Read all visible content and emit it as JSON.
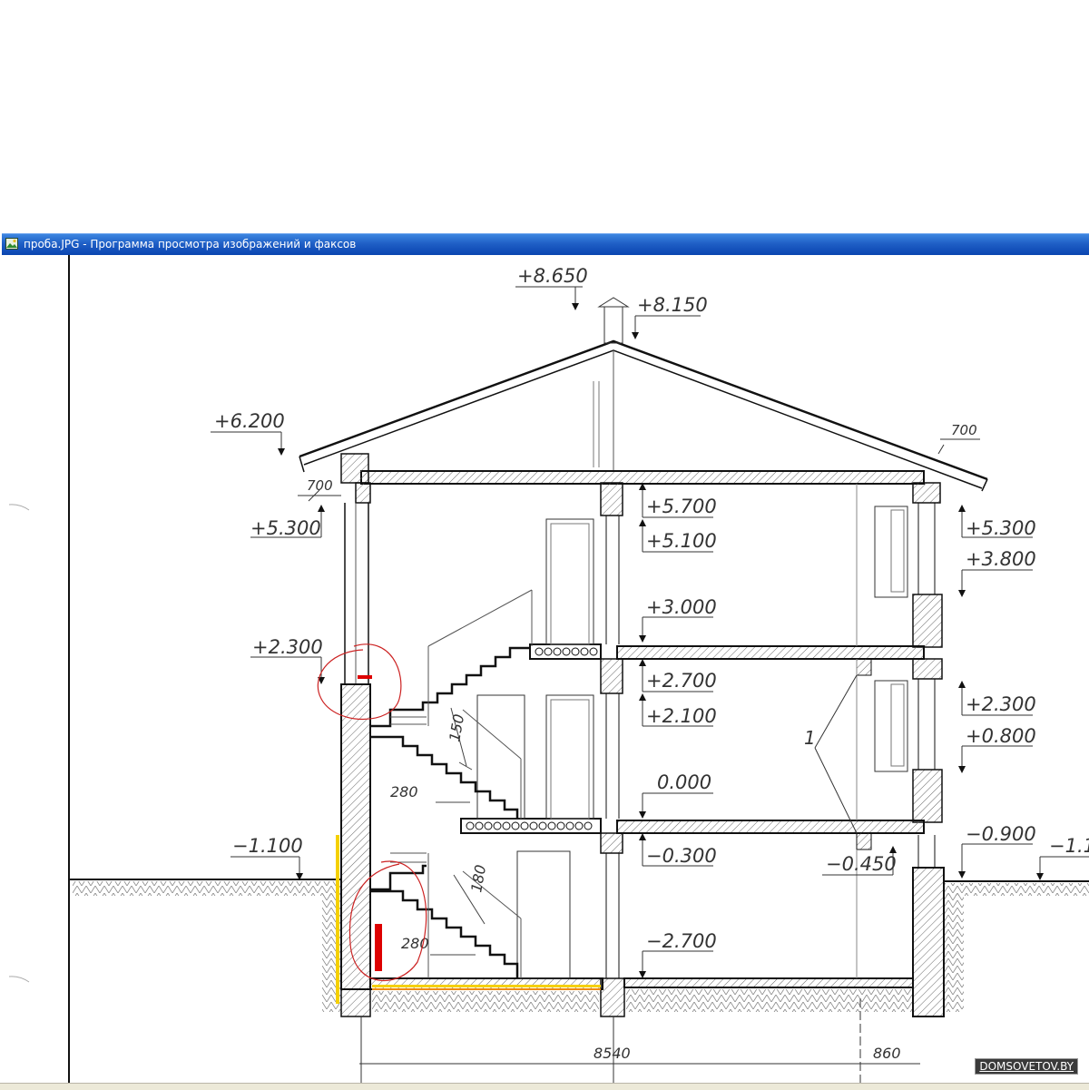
{
  "window": {
    "title": "проба.JPG - Программа просмотра изображений и факсов"
  },
  "drawing": {
    "elevations": {
      "e8650": "+8.650",
      "e8150": "+8.150",
      "e6200": "+6.200",
      "e5700": "+5.700",
      "e5300_left": "+5.300",
      "e5300_right": "+5.300",
      "e5100": "+5.100",
      "e3800": "+3.800",
      "e3000": "+3.000",
      "e2700": "+2.700",
      "e2300_left": "+2.300",
      "e2300_right": "+2.300",
      "e2100": "+2.100",
      "e0800": "+0.800",
      "e0000": "0.000",
      "em0300": "−0.300",
      "em0450": "−0.450",
      "em0900": "−0.900",
      "em1100_left": "−1.100",
      "em1100_right": "−1.1",
      "em2700": "−2.700"
    },
    "dimensions": {
      "d700_left": "700",
      "d700_right": "700",
      "d150": "150",
      "d280_upper": "280",
      "d180": "180",
      "d280_lower": "280",
      "d8540": "8540",
      "d860": "860",
      "callout_1": "1"
    }
  },
  "watermark": "DOMSOVETOV.BY",
  "colors": {
    "titlebar": "#1f5fc6",
    "markup_red": "#cc0000",
    "markup_yellow": "#f5d000",
    "markup_orange": "#f08a00"
  }
}
